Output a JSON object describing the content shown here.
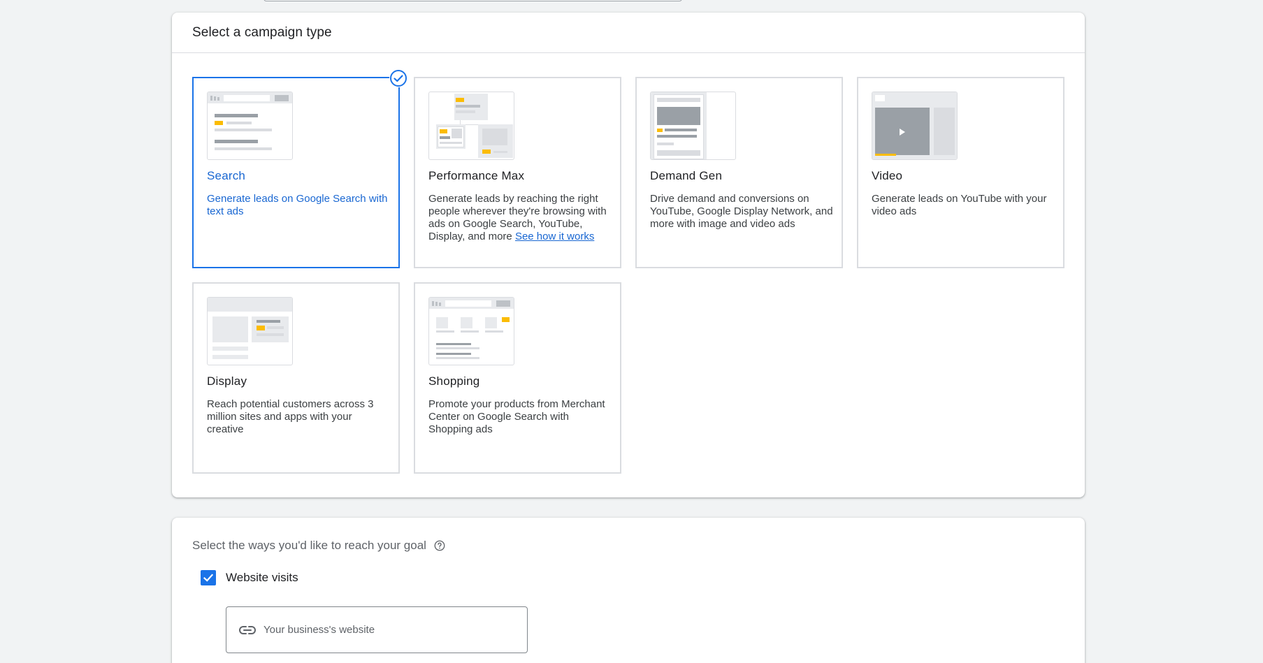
{
  "campaign_section": {
    "title": "Select a campaign type",
    "cards": [
      {
        "name": "Search",
        "description": "Generate leads on Google Search with text ads",
        "selected": true
      },
      {
        "name": "Performance Max",
        "description": "Generate leads by reaching the right people wherever they're browsing with ads on Google Search, YouTube, Display, and more",
        "link": "See how it works",
        "selected": false
      },
      {
        "name": "Demand Gen",
        "description": "Drive demand and conversions on YouTube, Google Display Network, and more with image and video ads",
        "selected": false
      },
      {
        "name": "Video",
        "description": "Generate leads on YouTube with your video ads",
        "selected": false
      },
      {
        "name": "Display",
        "description": "Reach potential customers across 3 million sites and apps with your creative",
        "selected": false
      },
      {
        "name": "Shopping",
        "description": "Promote your products from Merchant Center on Google Search with Shopping ads",
        "selected": false
      }
    ]
  },
  "goal_section": {
    "title": "Select the ways you'd like to reach your goal",
    "website_visits": {
      "label": "Website visits",
      "checked": true
    },
    "website_input": {
      "placeholder": "Your business's website",
      "value": ""
    }
  },
  "colors": {
    "accent": "#1a73e8",
    "accent_text": "#1967d2",
    "highlight": "#fbbc04",
    "border": "#dadce0",
    "background": "#f1f3f4"
  }
}
